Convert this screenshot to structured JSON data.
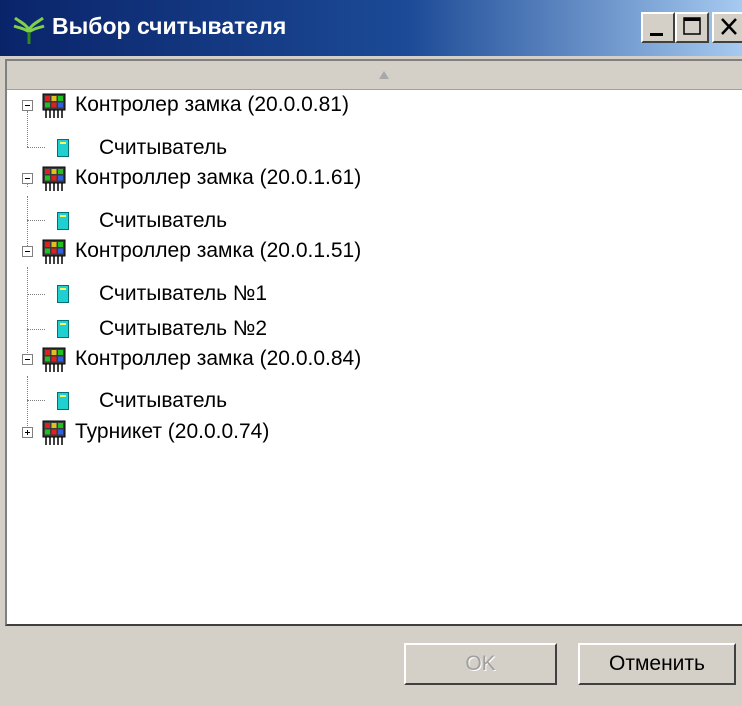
{
  "window": {
    "title": "Выбор считывателя",
    "controls": {
      "minimize": "minimize",
      "maximize": "maximize",
      "close": "close"
    }
  },
  "tree": {
    "nodes": [
      {
        "label": "Контролер замка (20.0.0.81)",
        "expanded": true,
        "icon": "controller-icon",
        "children": [
          {
            "label": "Считыватель",
            "icon": "reader-icon"
          }
        ]
      },
      {
        "label": "Контроллер замка (20.0.1.61)",
        "expanded": true,
        "icon": "controller-icon",
        "children": [
          {
            "label": "Считыватель",
            "icon": "reader-icon"
          }
        ]
      },
      {
        "label": "Контроллер замка (20.0.1.51)",
        "expanded": true,
        "icon": "controller-icon",
        "children": [
          {
            "label": "Считыватель №1",
            "icon": "reader-icon"
          },
          {
            "label": "Считыватель №2",
            "icon": "reader-icon"
          }
        ]
      },
      {
        "label": "Контроллер замка (20.0.0.84)",
        "expanded": true,
        "icon": "controller-icon",
        "children": [
          {
            "label": "Считыватель",
            "icon": "reader-icon"
          }
        ]
      },
      {
        "label": "Турникет (20.0.0.74)",
        "expanded": false,
        "icon": "controller-icon",
        "children": []
      }
    ]
  },
  "buttons": {
    "ok": "OK",
    "cancel": "Отменить"
  },
  "colors": {
    "titlebar_start": "#0a246a",
    "titlebar_end": "#a6caf0",
    "face": "#d4d0c8"
  }
}
